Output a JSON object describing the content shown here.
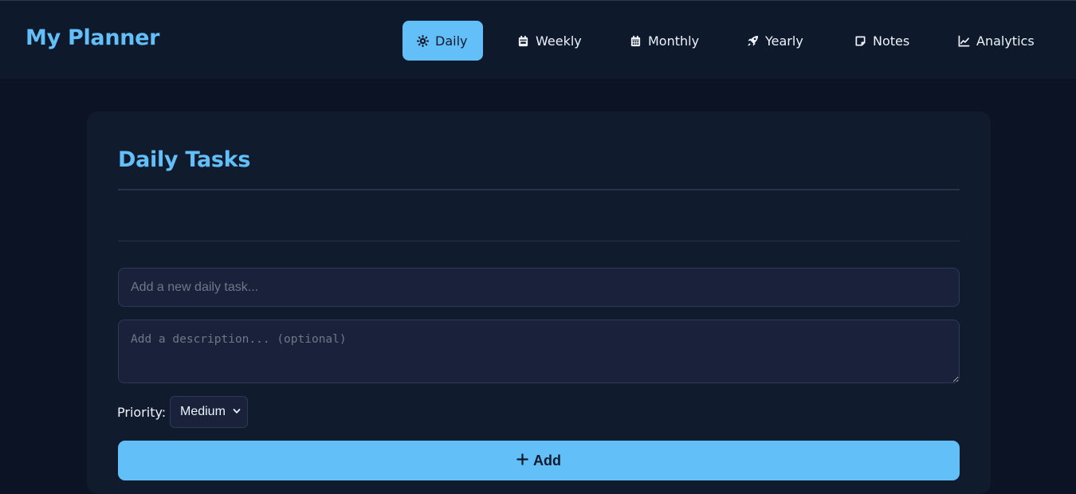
{
  "app": {
    "title": "My Planner"
  },
  "nav": {
    "items": [
      {
        "label": "Daily",
        "icon": "sun-icon",
        "active": true
      },
      {
        "label": "Weekly",
        "icon": "calendar-week-icon",
        "active": false
      },
      {
        "label": "Monthly",
        "icon": "calendar-month-icon",
        "active": false
      },
      {
        "label": "Yearly",
        "icon": "rocket-icon",
        "active": false
      },
      {
        "label": "Notes",
        "icon": "note-icon",
        "active": false
      },
      {
        "label": "Analytics",
        "icon": "line-chart-icon",
        "active": false
      }
    ]
  },
  "main": {
    "title": "Daily Tasks",
    "task_placeholder": "Add a new daily task...",
    "description_placeholder": "Add a description... (optional)",
    "priority_label": "Priority:",
    "priority_selected": "Medium",
    "add_label": "Add"
  },
  "colors": {
    "accent": "#63bff8",
    "background": "#0b1324",
    "surface": "#111b2e",
    "input": "#19223a"
  }
}
